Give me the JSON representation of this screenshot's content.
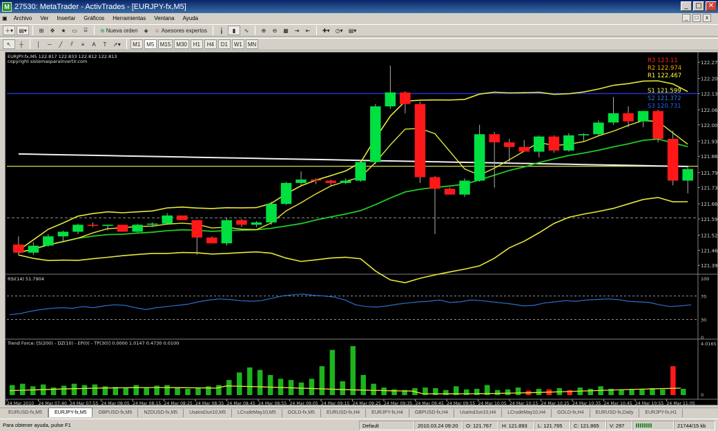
{
  "window": {
    "title": "27530: MetaTrader - ActivTrades - [EURJPY-fx,M5]",
    "app_icon": "metatrader-icon",
    "buttons": {
      "minimize": "_",
      "maximize": "□",
      "close": "✕"
    }
  },
  "menu": {
    "items": [
      "Archivo",
      "Ver",
      "Insertar",
      "Gráficos",
      "Herramientas",
      "Ventana",
      "Ayuda"
    ],
    "mdi_buttons": [
      "_",
      "□",
      "x"
    ]
  },
  "toolbar1": {
    "new_order_label": "Nueva orden",
    "expert_advisors_label": "Asesores expertos"
  },
  "toolbar2": {
    "text_tool": "A",
    "label_tool": "T",
    "timeframes": [
      "M1",
      "M5",
      "M15",
      "M30",
      "H1",
      "H4",
      "D1",
      "W1",
      "MN"
    ]
  },
  "chart": {
    "symbol_header": "EURJPY-fx,M5  122.817 122.833 122.812 122.813",
    "copyright": "copyright sistemasparainvertir.com",
    "pivots": [
      {
        "label": "R3 123.11",
        "color": "#ff2020"
      },
      {
        "label": "R2 122.974",
        "color": "#ffa500"
      },
      {
        "label": "R1 122.467",
        "color": "#ffff40"
      },
      {
        "label": "S1 121.599",
        "color": "#ffff40"
      },
      {
        "label": "S2 121.372",
        "color": "#3a6fe0"
      },
      {
        "label": "S3 120.731",
        "color": "#2060ff"
      }
    ],
    "current_price": "122.813",
    "price_ticks": [
      "122.270",
      "122.200",
      "122.135",
      "122.065",
      "122.000",
      "121.930",
      "121.865",
      "121.795",
      "121.730",
      "121.660",
      "121.595",
      "121.525",
      "121.460",
      "121.395"
    ],
    "colors": {
      "bull": "#00e040",
      "bear": "#ff1818",
      "ma_white": "#f0f0f0",
      "ma_green": "#22cc22",
      "band_yellow": "#e8e83a",
      "pivot_blue": "#2030c0",
      "rsi": "#2a6fcc"
    }
  },
  "chart_data": [
    {
      "type": "candlestick",
      "title": "EURJPY-fx,M5",
      "ylim": [
        121.36,
        122.3
      ],
      "ohlc": [
        [
          121.485,
          121.52,
          121.44,
          121.45
        ],
        [
          121.45,
          121.495,
          121.44,
          121.48
        ],
        [
          121.48,
          121.53,
          121.475,
          121.52
        ],
        [
          121.52,
          121.545,
          121.5,
          121.54
        ],
        [
          121.54,
          121.575,
          121.53,
          121.57
        ],
        [
          121.57,
          121.58,
          121.56,
          121.565
        ],
        [
          121.565,
          121.57,
          121.545,
          121.57
        ],
        [
          121.57,
          121.57,
          121.54,
          121.54
        ],
        [
          121.54,
          121.575,
          121.535,
          121.57
        ],
        [
          121.57,
          121.58,
          121.56,
          121.575
        ],
        [
          121.575,
          121.62,
          121.57,
          121.61
        ],
        [
          121.61,
          121.61,
          121.59,
          121.59
        ],
        [
          121.59,
          121.59,
          121.44,
          121.515
        ],
        [
          121.515,
          121.52,
          121.49,
          121.49
        ],
        [
          121.49,
          121.6,
          121.48,
          121.59
        ],
        [
          121.59,
          121.595,
          121.56,
          121.57
        ],
        [
          121.57,
          121.585,
          121.56,
          121.58
        ],
        [
          121.58,
          121.67,
          121.57,
          121.66
        ],
        [
          121.66,
          121.755,
          121.655,
          121.75
        ],
        [
          121.75,
          121.8,
          121.74,
          121.765
        ],
        [
          121.765,
          121.77,
          121.745,
          121.76
        ],
        [
          121.76,
          121.765,
          121.74,
          121.75
        ],
        [
          121.75,
          121.77,
          121.745,
          121.76
        ],
        [
          121.76,
          121.85,
          121.755,
          121.84
        ],
        [
          121.84,
          122.09,
          121.83,
          122.08
        ],
        [
          122.08,
          122.255,
          122.07,
          122.14
        ],
        [
          122.14,
          122.145,
          122.05,
          122.09
        ],
        [
          122.09,
          122.1,
          121.75,
          121.775
        ],
        [
          121.775,
          121.78,
          121.53,
          121.725
        ],
        [
          121.725,
          121.73,
          121.7,
          121.7
        ],
        [
          121.7,
          121.77,
          121.69,
          121.76
        ],
        [
          121.76,
          122.0,
          121.755,
          121.96
        ],
        [
          121.96,
          121.97,
          121.73,
          121.925
        ],
        [
          121.925,
          121.94,
          121.84,
          121.905
        ],
        [
          121.905,
          121.935,
          121.885,
          121.885
        ],
        [
          121.885,
          121.955,
          121.86,
          121.95
        ],
        [
          121.95,
          121.955,
          121.88,
          121.89
        ],
        [
          121.89,
          121.965,
          121.885,
          121.955
        ],
        [
          121.955,
          121.965,
          121.93,
          121.96
        ],
        [
          121.96,
          122.02,
          121.955,
          122.01
        ],
        [
          122.01,
          122.12,
          122.0,
          122.05
        ],
        [
          122.05,
          122.08,
          121.99,
          122.015
        ],
        [
          122.015,
          122.06,
          121.99,
          122.06
        ],
        [
          122.06,
          122.065,
          121.925,
          121.94
        ],
        [
          121.94,
          121.975,
          121.74,
          121.76
        ],
        [
          121.76,
          121.825,
          121.705,
          121.81
        ]
      ]
    },
    {
      "type": "line",
      "title": "RSI(14) 51.7904",
      "ylim": [
        0,
        100
      ],
      "levels": [
        70,
        30
      ],
      "values": [
        38,
        40,
        44,
        47,
        49,
        50,
        49,
        52,
        50,
        53,
        55,
        54,
        50,
        47,
        50,
        52,
        54,
        56,
        60,
        63,
        65,
        64,
        62,
        61,
        62,
        66,
        70,
        72,
        73,
        71,
        70,
        68,
        63,
        55,
        52,
        51,
        53,
        56,
        58,
        60,
        61,
        63,
        59,
        60,
        63,
        62,
        60,
        58,
        56,
        53,
        54,
        58,
        60,
        62,
        61,
        63,
        64,
        65,
        64,
        61,
        60,
        59,
        55,
        52,
        53,
        55
      ]
    },
    {
      "type": "bar",
      "title": "Trend Force: [S(200) - DZ(10) - EP(0) - TP(30)] 0.0000 1.0147 0.4730 0.0100",
      "ylim": [
        0,
        4.0165
      ],
      "values": [
        0.8,
        0.9,
        0.7,
        0.85,
        0.6,
        0.75,
        0.9,
        0.8,
        0.85,
        0.7,
        0.65,
        0.6,
        0.8,
        0.6,
        0.75,
        0.8,
        0.6,
        0.5,
        0.55,
        0.7,
        0.8,
        1.2,
        1.8,
        2.2,
        2.0,
        1.6,
        1.3,
        1.2,
        1.0,
        1.3,
        2.3,
        3.6,
        1.1,
        3.9,
        1.6,
        0.9,
        0.6,
        0.45,
        0.4,
        0.55,
        0.6,
        0.55,
        0.4,
        0.7,
        0.45,
        0.5,
        0.8,
        0.4,
        0.45,
        0.6,
        0.35,
        0.5,
        0.45,
        0.55,
        0.4,
        0.6,
        0.5,
        0.7,
        0.5,
        0.4,
        0.45,
        0.5,
        0.55,
        0.45,
        2.3,
        0.5
      ],
      "bear_indices": [
        50,
        52,
        54,
        64
      ]
    }
  ],
  "panels": {
    "rsi_levels": [
      "100",
      "70",
      "30",
      "0"
    ],
    "trend_top_label": "4.0165",
    "trend_zero_label": "0"
  },
  "time_axis": [
    "24 Mar 2010",
    "24 Mar 07:40",
    "24 Mar 07:55",
    "24 Mar 08:05",
    "24 Mar 08:15",
    "24 Mar 08:25",
    "24 Mar 08:35",
    "24 Mar 08:45",
    "24 Mar 08:55",
    "24 Mar 09:05",
    "24 Mar 09:15",
    "24 Mar 09:25",
    "24 Mar 09:35",
    "24 Mar 09:45",
    "24 Mar 09:55",
    "24 Mar 10:05",
    "24 Mar 10:15",
    "24 Mar 10:25",
    "24 Mar 10:35",
    "24 Mar 10:45",
    "24 Mar 10:55",
    "24 Mar 11:05"
  ],
  "tabs": [
    "EURUSD-fx,M5",
    "EURJPY-fx,M5",
    "GBPUSD-fx,M5",
    "NZDUSD-fx,M5",
    "UsaIndJun10,M5",
    "LCrudeMay10,M5",
    "GOLD-fx,M5",
    "EURUSD-fx,H4",
    "EURJPY-fx,H4",
    "GBPUSD-fx,H4",
    "UsaIndJun10,H4",
    "LCrudeMay10,H4",
    "GOLD-fx,H4",
    "EURUSD-fx,Daily",
    "EURJPY-fx,H1"
  ],
  "active_tab": 1,
  "status": {
    "help": "Para obtener ayuda, pulse F1",
    "profile": "Default",
    "datetime": "2010.03.24 09:20",
    "open": "O: 121.767",
    "high": "H: 121.893",
    "low": "L: 121.765",
    "close": "C: 121.865",
    "volume": "V: 297",
    "traffic": "21744/15 kb"
  }
}
